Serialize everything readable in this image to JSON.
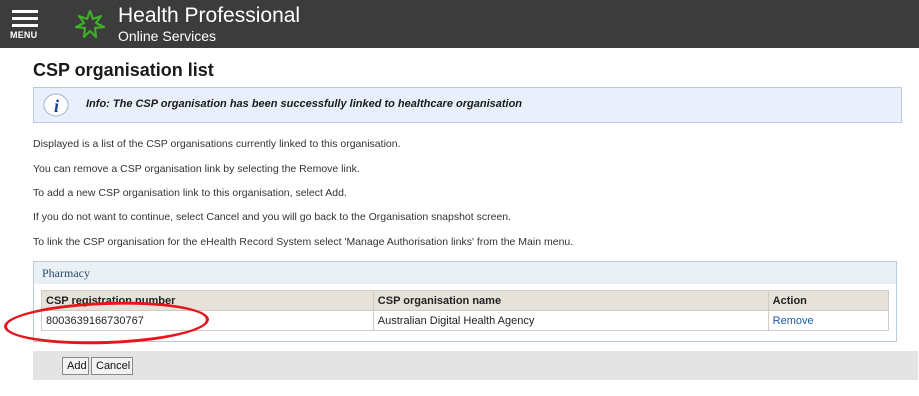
{
  "header": {
    "menu_label": "MENU",
    "brand_line1": "Health Professional",
    "brand_line2": "Online Services"
  },
  "page": {
    "title": "CSP organisation list"
  },
  "info": {
    "message": "Info: The CSP organisation has been successfully linked to healthcare organisation"
  },
  "paragraphs": [
    "Displayed is a list of the CSP organisations currently linked to this organisation.",
    "You can remove a CSP organisation link by selecting the Remove link.",
    "To add a new CSP organisation link to this organisation, select Add.",
    "If you do not want to continue, select Cancel and you will go back to the Organisation snapshot screen.",
    "To link the CSP organisation for the eHealth Record System select 'Manage Authorisation links' from the Main menu."
  ],
  "panel": {
    "title": "Pharmacy",
    "columns": [
      "CSP registration number",
      "CSP organisation name",
      "Action"
    ],
    "rows": [
      {
        "registration_number": "8003639166730767",
        "organisation_name": "Australian Digital Health Agency",
        "action": "Remove"
      }
    ]
  },
  "buttons": {
    "add": "Add",
    "cancel": "Cancel"
  },
  "colors": {
    "header_bg": "#3c3c3c",
    "info_bg": "#eaf0fb",
    "annotation": "#e8151b",
    "link": "#1f5ca8"
  }
}
